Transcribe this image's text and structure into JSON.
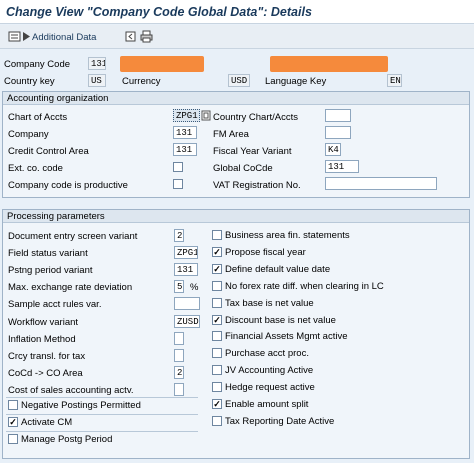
{
  "title": "Change View \"Company Code Global Data\": Details",
  "toolbar": {
    "additional_data": "Additional Data"
  },
  "header": {
    "company_code_label": "Company Code",
    "company_code_value": "131",
    "country_key_label": "Country key",
    "country_key_value": "US",
    "currency_label": "Currency",
    "currency_value": "USD",
    "language_key_label": "Language Key",
    "language_key_value": "EN"
  },
  "accounting_org": {
    "title": "Accounting organization",
    "chart_of_accts_label": "Chart of Accts",
    "chart_of_accts_value": "ZPG1",
    "country_chart_label": "Country Chart/Accts",
    "country_chart_value": "",
    "company_label": "Company",
    "company_value": "131",
    "fm_area_label": "FM Area",
    "fm_area_value": "",
    "credit_control_label": "Credit Control Area",
    "credit_control_value": "131",
    "fiscal_year_variant_label": "Fiscal Year Variant",
    "fiscal_year_variant_value": "K4",
    "ext_co_code_label": "Ext. co. code",
    "global_cocde_label": "Global CoCde",
    "global_cocde_value": "131",
    "productive_label": "Company code is productive",
    "vat_reg_label": "VAT Registration No.",
    "vat_reg_value": ""
  },
  "processing": {
    "title": "Processing parameters",
    "left_fields": [
      {
        "label": "Document entry screen variant",
        "value": "2"
      },
      {
        "label": "Field status variant",
        "value": "ZPG1"
      },
      {
        "label": "Pstng period variant",
        "value": "131"
      },
      {
        "label": "Max. exchange rate deviation",
        "value": "5",
        "unit": "%"
      },
      {
        "label": "Sample acct rules var.",
        "value": ""
      },
      {
        "label": "Workflow variant",
        "value": "ZUSD"
      },
      {
        "label": "Inflation Method",
        "value": ""
      },
      {
        "label": "Crcy transl. for tax",
        "value": ""
      },
      {
        "label": "CoCd -> CO Area",
        "value": "2"
      },
      {
        "label": "Cost of sales accounting actv.",
        "value": ""
      }
    ],
    "left_checks": [
      {
        "label": "Negative Postings Permitted",
        "checked": false
      },
      {
        "label": "Activate CM",
        "checked": true
      },
      {
        "label": "Manage Postg Period",
        "checked": false
      }
    ],
    "right_checks": [
      {
        "label": "Business area fin. statements",
        "checked": false
      },
      {
        "label": "Propose fiscal year",
        "checked": true
      },
      {
        "label": "Define default value date",
        "checked": true
      },
      {
        "label": "No forex rate diff. when clearing in LC",
        "checked": false
      },
      {
        "label": "Tax base is net value",
        "checked": false
      },
      {
        "label": "Discount base is net value",
        "checked": true
      },
      {
        "label": "Financial Assets Mgmt active",
        "checked": false
      },
      {
        "label": "Purchase acct proc.",
        "checked": false
      },
      {
        "label": "JV Accounting Active",
        "checked": false
      },
      {
        "label": "Hedge request active",
        "checked": false
      },
      {
        "label": "Enable amount split",
        "checked": true
      },
      {
        "label": "Tax Reporting Date Active",
        "checked": false
      }
    ]
  },
  "colors": {
    "redaction": "#f58a3c",
    "title": "#1a3a5c",
    "background": "#e8f0f8"
  }
}
